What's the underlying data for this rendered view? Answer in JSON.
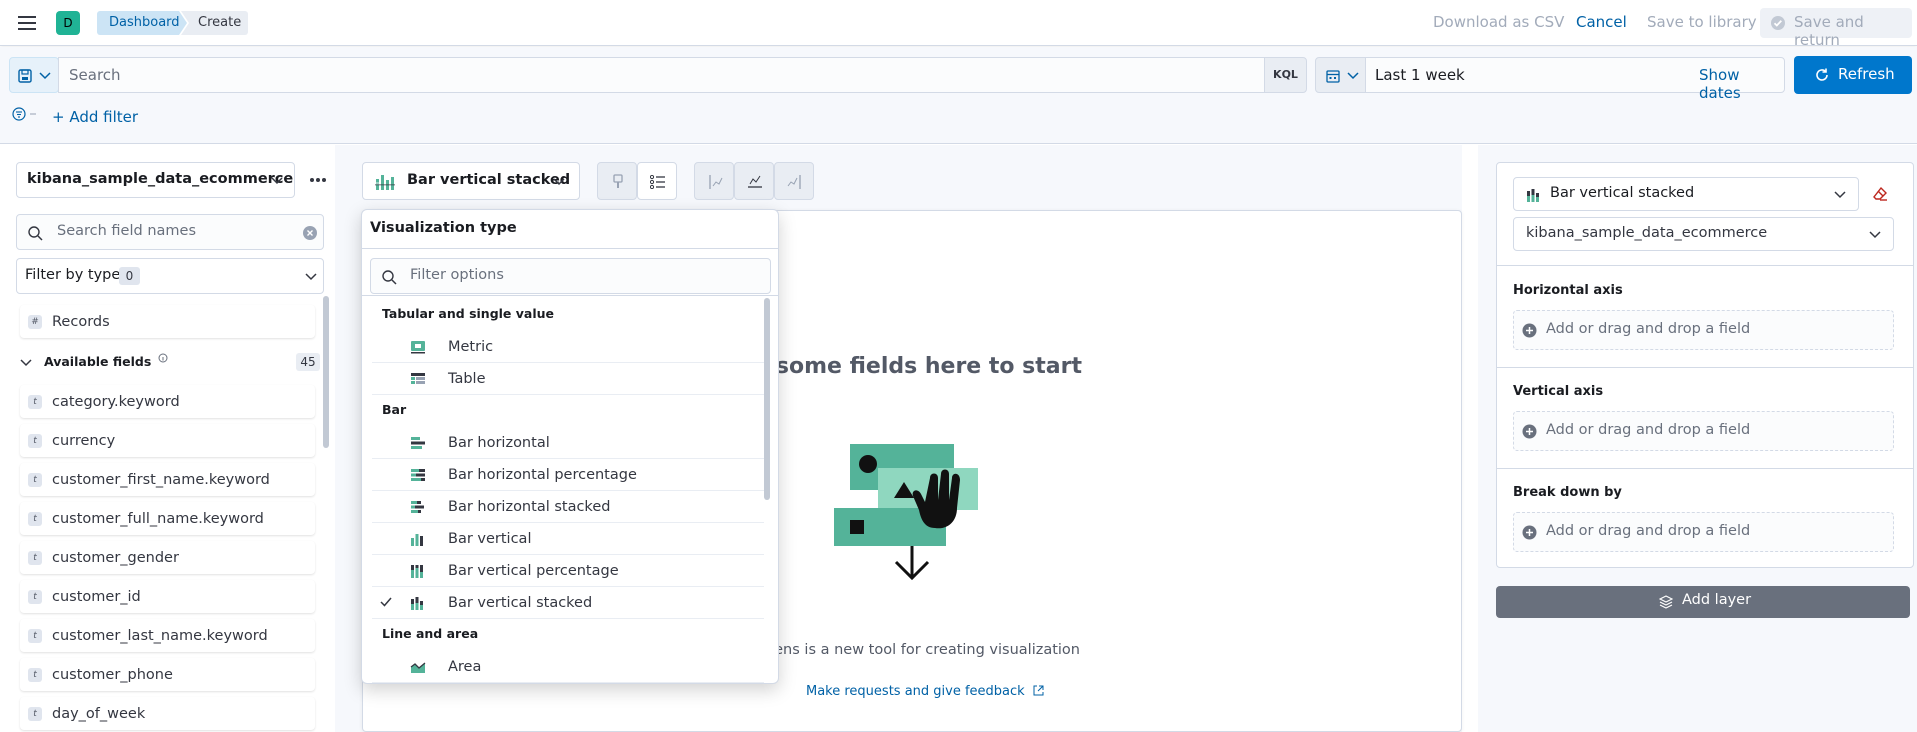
{
  "header": {
    "menu_icon": "hamburger-icon",
    "avatar_letter": "D",
    "breadcrumbs": [
      "Dashboard",
      "Create"
    ],
    "download_csv": "Download as CSV",
    "cancel": "Cancel",
    "save_library": "Save to library",
    "save_return": "Save and return"
  },
  "query": {
    "search_placeholder": "Search",
    "kql": "KQL",
    "date_range": "Last 1 week",
    "show_dates": "Show dates",
    "refresh": "Refresh",
    "add_filter": "+ Add filter"
  },
  "left": {
    "index_pattern": "kibana_sample_data_ecommerce",
    "search_fields_placeholder": "Search field names",
    "filter_by_type": "Filter by type",
    "filter_count": "0",
    "records": "Records",
    "available_fields": "Available fields",
    "available_count": "45",
    "fields": [
      "category.keyword",
      "currency",
      "customer_first_name.keyword",
      "customer_full_name.keyword",
      "customer_gender",
      "customer_id",
      "customer_last_name.keyword",
      "customer_phone",
      "day_of_week"
    ]
  },
  "workspace": {
    "chart_switch": "Bar vertical stacked",
    "empty_title": "Drop some fields here to start",
    "empty_desc": "Lens is a new tool for creating visualization",
    "feedback_link": "Make requests and give feedback"
  },
  "popover": {
    "title": "Visualization type",
    "filter_placeholder": "Filter options",
    "groups": {
      "tabular": "Tabular and single value",
      "bar": "Bar",
      "line": "Line and area"
    },
    "options": {
      "metric": "Metric",
      "table": "Table",
      "bar_h": "Bar horizontal",
      "bar_h_pct": "Bar horizontal percentage",
      "bar_h_stk": "Bar horizontal stacked",
      "bar_v": "Bar vertical",
      "bar_v_pct": "Bar vertical percentage",
      "bar_v_stk": "Bar vertical stacked",
      "area": "Area"
    },
    "selected": "Bar vertical stacked"
  },
  "right": {
    "layer_type": "Bar vertical stacked",
    "layer_index": "kibana_sample_data_ecommerce",
    "horizontal_axis": "Horizontal axis",
    "vertical_axis": "Vertical axis",
    "break_down": "Break down by",
    "drop_hint": "Add or drag and drop a field",
    "add_layer": "Add layer"
  },
  "colors": {
    "accent": "#0077cc",
    "teal": "#54b399",
    "avatar": "#20b395",
    "disabled": "#a2abba"
  }
}
